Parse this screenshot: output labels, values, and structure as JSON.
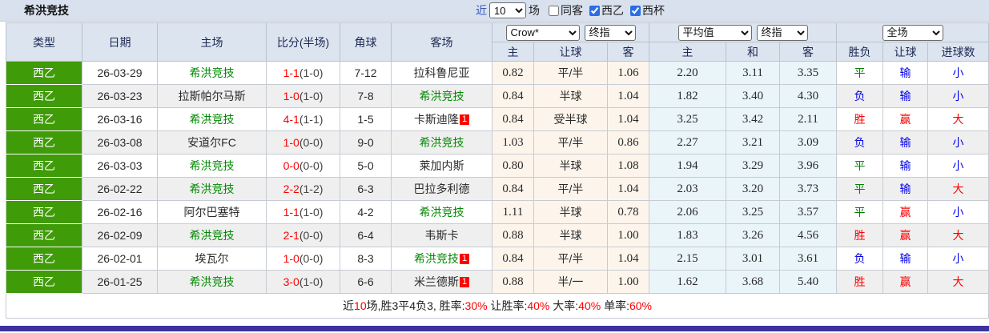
{
  "topbar": {
    "title": "希洪竞技",
    "near_label": "近",
    "matches_value": "10",
    "matches_suffix": "场",
    "filters": [
      {
        "label": "同客",
        "checked": false
      },
      {
        "label": "西乙",
        "checked": true
      },
      {
        "label": "西杯",
        "checked": true
      }
    ]
  },
  "table": {
    "left_headers": [
      "类型",
      "日期",
      "主场",
      "比分(半场)",
      "角球",
      "客场"
    ],
    "groups": [
      {
        "selects": [
          "Crow*",
          "终指"
        ],
        "cols": [
          "主",
          "让球",
          "客"
        ]
      },
      {
        "selects": [
          "平均值",
          "终指"
        ],
        "cols": [
          "主",
          "和",
          "客"
        ]
      },
      {
        "selects": [
          "全场"
        ],
        "cols": [
          "胜负",
          "让球",
          "进球数"
        ]
      }
    ],
    "rows": [
      {
        "league": "西乙",
        "date": "26-03-29",
        "home": "希洪竞技",
        "home_is_self": true,
        "home_badge": "",
        "score": "1-1",
        "half": "(1-0)",
        "corners": "7-12",
        "away": "拉科鲁尼亚",
        "away_is_self": false,
        "away_badge": "",
        "crow": [
          "0.82",
          "平/半",
          "1.06"
        ],
        "avg": [
          "2.20",
          "3.11",
          "3.35"
        ],
        "results": [
          {
            "t": "平",
            "c": "green"
          },
          {
            "t": "输",
            "c": "blue"
          },
          {
            "t": "小",
            "c": "blue"
          }
        ]
      },
      {
        "league": "西乙",
        "date": "26-03-23",
        "home": "拉斯帕尔马斯",
        "home_is_self": false,
        "home_badge": "",
        "score": "1-0",
        "half": "(1-0)",
        "corners": "7-8",
        "away": "希洪竞技",
        "away_is_self": true,
        "away_badge": "",
        "crow": [
          "0.84",
          "半球",
          "1.04"
        ],
        "avg": [
          "1.82",
          "3.40",
          "4.30"
        ],
        "results": [
          {
            "t": "负",
            "c": "blue"
          },
          {
            "t": "输",
            "c": "blue"
          },
          {
            "t": "小",
            "c": "blue"
          }
        ]
      },
      {
        "league": "西乙",
        "date": "26-03-16",
        "home": "希洪竞技",
        "home_is_self": true,
        "home_badge": "",
        "score": "4-1",
        "half": "(1-1)",
        "corners": "1-5",
        "away": "卡斯迪隆",
        "away_is_self": false,
        "away_badge": "1",
        "crow": [
          "0.84",
          "受半球",
          "1.04"
        ],
        "avg": [
          "3.25",
          "3.42",
          "2.11"
        ],
        "results": [
          {
            "t": "胜",
            "c": "red"
          },
          {
            "t": "赢",
            "c": "red"
          },
          {
            "t": "大",
            "c": "red"
          }
        ]
      },
      {
        "league": "西乙",
        "date": "26-03-08",
        "home": "安道尔FC",
        "home_is_self": false,
        "home_badge": "",
        "score": "1-0",
        "half": "(0-0)",
        "corners": "9-0",
        "away": "希洪竞技",
        "away_is_self": true,
        "away_badge": "",
        "crow": [
          "1.03",
          "平/半",
          "0.86"
        ],
        "avg": [
          "2.27",
          "3.21",
          "3.09"
        ],
        "results": [
          {
            "t": "负",
            "c": "blue"
          },
          {
            "t": "输",
            "c": "blue"
          },
          {
            "t": "小",
            "c": "blue"
          }
        ]
      },
      {
        "league": "西乙",
        "date": "26-03-03",
        "home": "希洪竞技",
        "home_is_self": true,
        "home_badge": "",
        "score": "0-0",
        "half": "(0-0)",
        "corners": "5-0",
        "away": "莱加内斯",
        "away_is_self": false,
        "away_badge": "",
        "crow": [
          "0.80",
          "半球",
          "1.08"
        ],
        "avg": [
          "1.94",
          "3.29",
          "3.96"
        ],
        "results": [
          {
            "t": "平",
            "c": "green"
          },
          {
            "t": "输",
            "c": "blue"
          },
          {
            "t": "小",
            "c": "blue"
          }
        ]
      },
      {
        "league": "西乙",
        "date": "26-02-22",
        "home": "希洪竞技",
        "home_is_self": true,
        "home_badge": "",
        "score": "2-2",
        "half": "(1-2)",
        "corners": "6-3",
        "away": "巴拉多利德",
        "away_is_self": false,
        "away_badge": "",
        "crow": [
          "0.84",
          "平/半",
          "1.04"
        ],
        "avg": [
          "2.03",
          "3.20",
          "3.73"
        ],
        "results": [
          {
            "t": "平",
            "c": "green"
          },
          {
            "t": "输",
            "c": "blue"
          },
          {
            "t": "大",
            "c": "red"
          }
        ]
      },
      {
        "league": "西乙",
        "date": "26-02-16",
        "home": "阿尔巴塞特",
        "home_is_self": false,
        "home_badge": "",
        "score": "1-1",
        "half": "(1-0)",
        "corners": "4-2",
        "away": "希洪竞技",
        "away_is_self": true,
        "away_badge": "",
        "crow": [
          "1.11",
          "半球",
          "0.78"
        ],
        "avg": [
          "2.06",
          "3.25",
          "3.57"
        ],
        "results": [
          {
            "t": "平",
            "c": "green"
          },
          {
            "t": "赢",
            "c": "red"
          },
          {
            "t": "小",
            "c": "blue"
          }
        ]
      },
      {
        "league": "西乙",
        "date": "26-02-09",
        "home": "希洪竞技",
        "home_is_self": true,
        "home_badge": "",
        "score": "2-1",
        "half": "(0-0)",
        "corners": "6-4",
        "away": "韦斯卡",
        "away_is_self": false,
        "away_badge": "",
        "crow": [
          "0.88",
          "半球",
          "1.00"
        ],
        "avg": [
          "1.83",
          "3.26",
          "4.56"
        ],
        "results": [
          {
            "t": "胜",
            "c": "red"
          },
          {
            "t": "赢",
            "c": "red"
          },
          {
            "t": "大",
            "c": "red"
          }
        ]
      },
      {
        "league": "西乙",
        "date": "26-02-01",
        "home": "埃瓦尔",
        "home_is_self": false,
        "home_badge": "",
        "score": "1-0",
        "half": "(0-0)",
        "corners": "8-3",
        "away": "希洪竞技",
        "away_is_self": true,
        "away_badge": "1",
        "crow": [
          "0.84",
          "平/半",
          "1.04"
        ],
        "avg": [
          "2.15",
          "3.01",
          "3.61"
        ],
        "results": [
          {
            "t": "负",
            "c": "blue"
          },
          {
            "t": "输",
            "c": "blue"
          },
          {
            "t": "小",
            "c": "blue"
          }
        ]
      },
      {
        "league": "西乙",
        "date": "26-01-25",
        "home": "希洪竞技",
        "home_is_self": true,
        "home_badge": "",
        "score": "3-0",
        "half": "(1-0)",
        "corners": "6-6",
        "away": "米兰德斯",
        "away_is_self": false,
        "away_badge": "1",
        "crow": [
          "0.88",
          "半/一",
          "1.00"
        ],
        "avg": [
          "1.62",
          "3.68",
          "5.40"
        ],
        "results": [
          {
            "t": "胜",
            "c": "red"
          },
          {
            "t": "赢",
            "c": "red"
          },
          {
            "t": "大",
            "c": "red"
          }
        ]
      }
    ]
  },
  "footer": {
    "segments": [
      {
        "text": "近",
        "red": false
      },
      {
        "text": "10",
        "red": true
      },
      {
        "text": "场,胜3平4负3, 胜率:",
        "red": false
      },
      {
        "text": "30%",
        "red": true
      },
      {
        "text": " 让胜率:",
        "red": false
      },
      {
        "text": "40%",
        "red": true
      },
      {
        "text": " 大率:",
        "red": false
      },
      {
        "text": "40%",
        "red": true
      },
      {
        "text": " 单率:",
        "red": false
      },
      {
        "text": "60%",
        "red": true
      }
    ]
  }
}
